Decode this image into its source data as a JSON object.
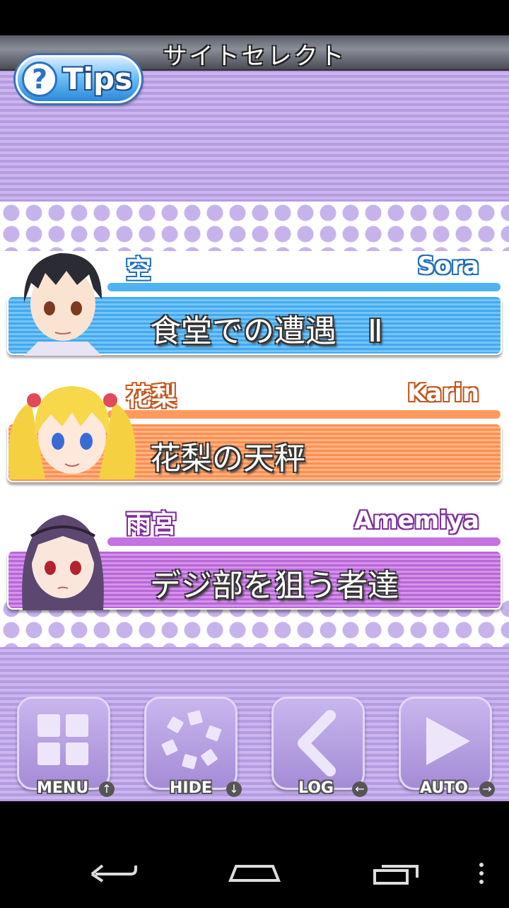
{
  "header": {
    "title": "サイトセレクト"
  },
  "tips": {
    "label": "Tips",
    "icon": "question-icon"
  },
  "sites": [
    {
      "jp_name": "空",
      "en_name": "Sora",
      "title": "食堂での遭遇　Ⅱ",
      "color": "#4fb3f2",
      "line_color": "#4fb3f2"
    },
    {
      "jp_name": "花梨",
      "en_name": "Karin",
      "title": "花梨の天秤",
      "color": "#ff9a5e",
      "line_color": "#ff9a5e"
    },
    {
      "jp_name": "雨宮",
      "en_name": "Amemiya",
      "title": "デジ部を狙う者達",
      "color": "#c473e0",
      "line_color": "#c473e0"
    }
  ],
  "controls": [
    {
      "label": "MENU",
      "icon": "grid-icon",
      "arrow": "↑"
    },
    {
      "label": "HIDE",
      "icon": "scatter-icon",
      "arrow": "↓"
    },
    {
      "label": "LOG",
      "icon": "chevron-left-icon",
      "arrow": "←"
    },
    {
      "label": "AUTO",
      "icon": "play-icon",
      "arrow": "→"
    }
  ],
  "navbar": {
    "icons": [
      "back-icon",
      "home-icon",
      "recent-apps-icon",
      "overflow-menu-icon"
    ]
  }
}
